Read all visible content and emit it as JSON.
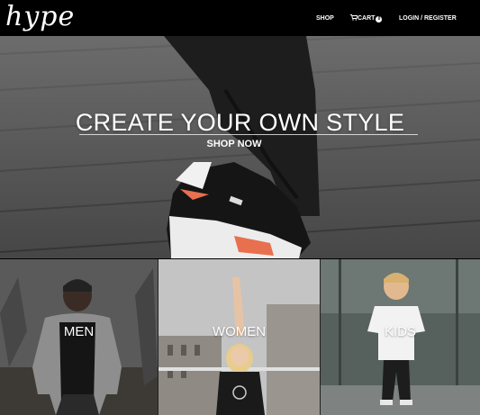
{
  "header": {
    "logo": "hype",
    "nav": {
      "shop": "SHOP",
      "cart": "CART",
      "cart_count": "0",
      "login": "LOGIN / REGISTER"
    }
  },
  "hero": {
    "title": "CREATE YOUR OWN STYLE",
    "cta": "SHOP NOW"
  },
  "categories": {
    "men": "MEN",
    "women": "WOMEN",
    "kids": "KIDS"
  },
  "colors": {
    "header_bg": "#000000",
    "text": "#ffffff",
    "accent_sole": "#e8704f"
  },
  "icons": [
    "cart-icon"
  ]
}
